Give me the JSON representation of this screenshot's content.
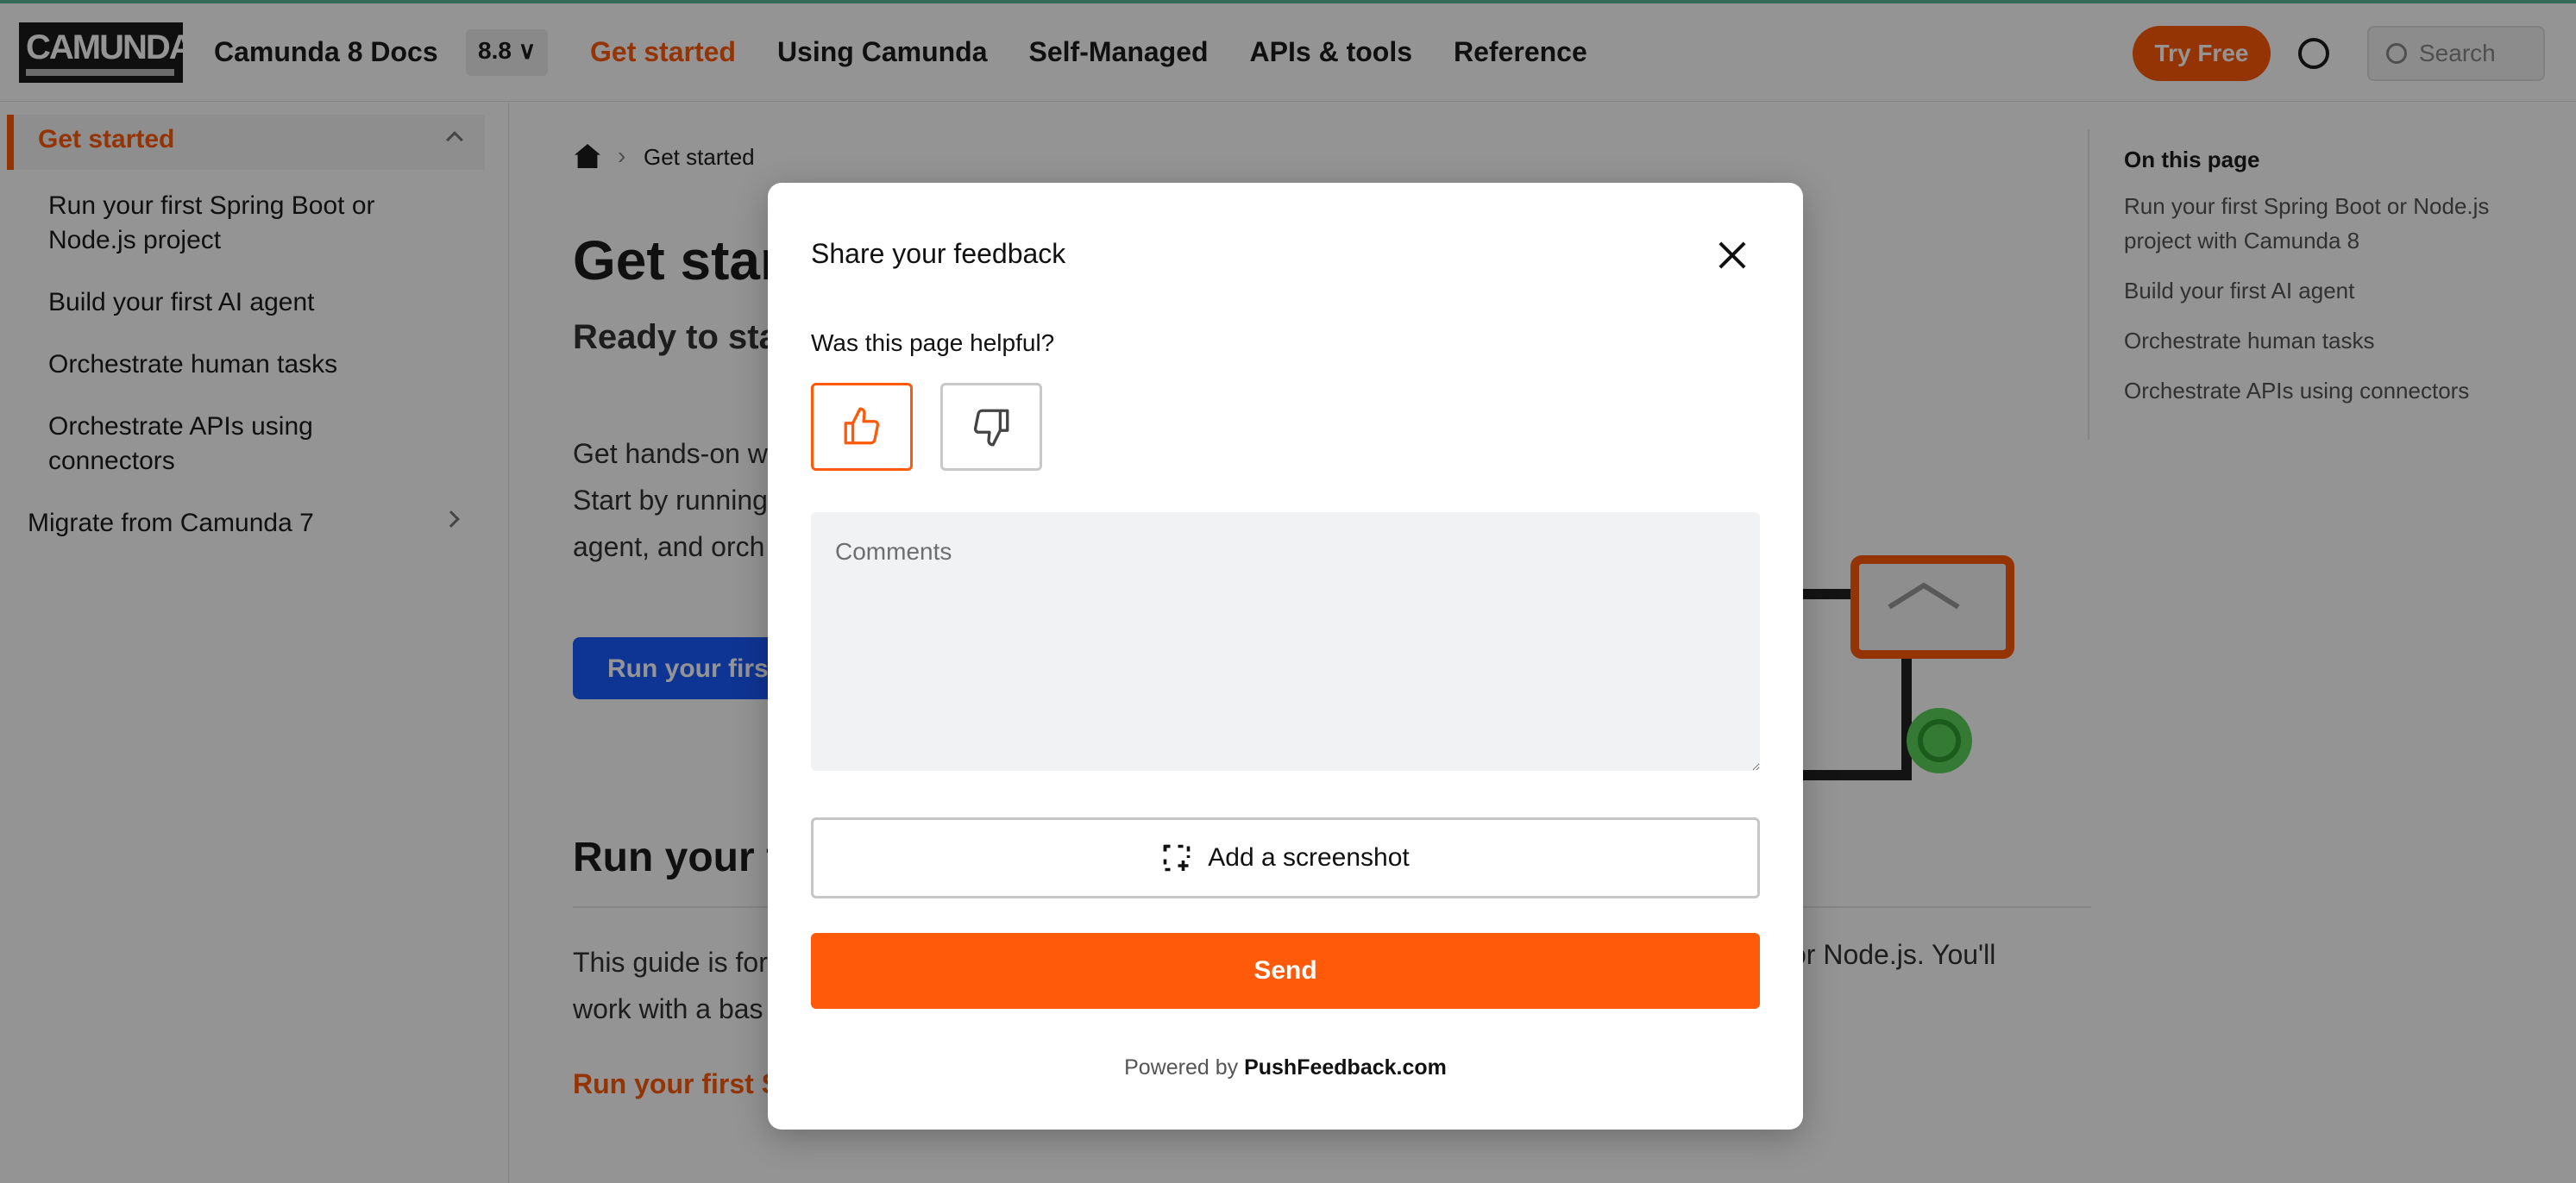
{
  "header": {
    "logo_text": "CAMUNDA",
    "brand_title": "Camunda 8 Docs",
    "version": "8.8 ∨",
    "nav": [
      {
        "label": "Get started",
        "active": true
      },
      {
        "label": "Using Camunda",
        "active": false
      },
      {
        "label": "Self-Managed",
        "active": false
      },
      {
        "label": "APIs & tools",
        "active": false
      },
      {
        "label": "Reference",
        "active": false
      }
    ],
    "try_free": "Try Free",
    "search_placeholder": "Search"
  },
  "sidebar": {
    "active": "Get started",
    "items": [
      "Run your first Spring Boot or Node.js project",
      "Build your first AI agent",
      "Orchestrate human tasks",
      "Orchestrate APIs using connectors"
    ],
    "migrate": "Migrate from Camunda 7"
  },
  "main": {
    "breadcrumb": "Get started",
    "title": "Get star",
    "lead": "Ready to sta",
    "paragraph_lines": [
      "Get hands-on w",
      "Start by running",
      "agent, and orch"
    ],
    "primary_button": "Run your first",
    "section_title": "Run your fi",
    "section_text": [
      "This guide is for",
      "work with a bas"
    ],
    "section_text_tail": "or Node.js. You'll",
    "section_link": "Run your first S"
  },
  "toc": {
    "title": "On this page",
    "items": [
      "Run your first Spring Boot or Node.js project with Camunda 8",
      "Build your first AI agent",
      "Orchestrate human tasks",
      "Orchestrate APIs using connectors"
    ]
  },
  "modal": {
    "title": "Share your feedback",
    "question": "Was this page helpful?",
    "selected_vote": "thumbs-up",
    "comments_placeholder": "Comments",
    "screenshot_label": "Add a screenshot",
    "send_label": "Send",
    "powered_prefix": "Powered by",
    "powered_link": "PushFeedback.com"
  },
  "colors": {
    "accent": "#ff5a0a",
    "primary_blue": "#1b5cff",
    "overlay": "rgba(0,0,0,0.42)"
  }
}
